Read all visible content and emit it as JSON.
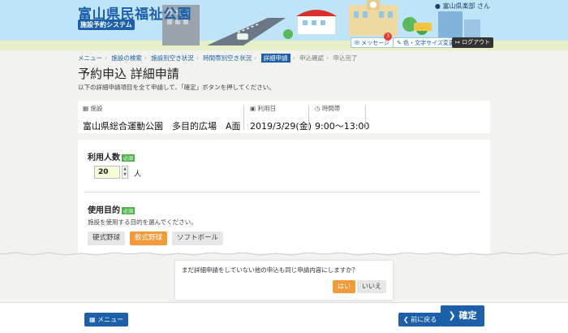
{
  "header": {
    "title": "富山県民福祉公園",
    "subtitle": "施設予約システム",
    "user": "富山県楽部 さん",
    "message_label": "メッセージ",
    "message_count": "3",
    "color_label": "色・文字サイズ変更",
    "logout_label": "ログアウト"
  },
  "breadcrumb": [
    {
      "label": "メニュー",
      "state": "link"
    },
    {
      "label": "施設の検索",
      "state": "link"
    },
    {
      "label": "施設別空き状況",
      "state": "link"
    },
    {
      "label": "時間帯別空き状況",
      "state": "link"
    },
    {
      "label": "詳細申請",
      "state": "current"
    },
    {
      "label": "申込確認",
      "state": "todo"
    },
    {
      "label": "申込完了",
      "state": "todo"
    }
  ],
  "page": {
    "title": "予約申込 詳細申請",
    "description": "以下の詳細申請項目を全て申請して、「確定」ボタンを押してください。"
  },
  "summary": {
    "facility_label": "施設",
    "facility_value": "富山県総合運動公園　多目的広場　A面",
    "date_label": "利用日",
    "date_value": "2019/3/29(金)",
    "time_label": "時間帯",
    "time_value": "9:00～13:00"
  },
  "form": {
    "people_label": "利用人数",
    "required": "必須",
    "people_value": "20",
    "people_unit": "人",
    "purpose_label": "使用目的",
    "purpose_help": "施設を使用する目的を選んでください。",
    "purpose_options": [
      {
        "label": "硬式野球",
        "selected": false
      },
      {
        "label": "軟式野球",
        "selected": true
      },
      {
        "label": "ソフトボール",
        "selected": false
      }
    ]
  },
  "popup": {
    "text": "まだ詳細申請をしていない他の申込も同じ申請内容にしますか？",
    "yes_label": "はい",
    "no_label": "いいえ"
  },
  "footer": {
    "menu_label": "メニュー",
    "back_label": "前に戻る",
    "confirm_label": "確定"
  },
  "colors": {
    "primary": "#1d5fa8",
    "accent": "#f29a3a",
    "required": "#4db24a",
    "badge": "#e63a2e"
  }
}
